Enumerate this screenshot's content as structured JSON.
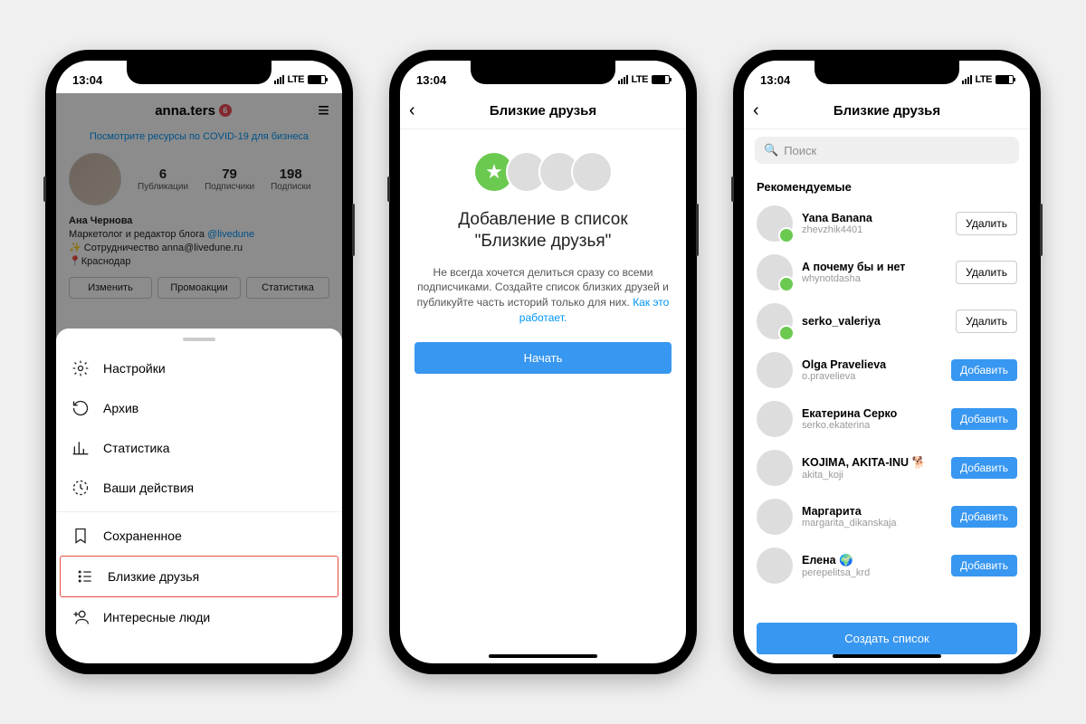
{
  "status": {
    "time": "13:04",
    "net": "LTE"
  },
  "phone1": {
    "username": "anna.ters",
    "badge": "6",
    "covid_link": "Посмотрите ресурсы по COVID-19 для бизнеса",
    "stats": [
      {
        "n": "6",
        "l": "Публикации"
      },
      {
        "n": "79",
        "l": "Подписчики"
      },
      {
        "n": "198",
        "l": "Подписки"
      }
    ],
    "bio_name": "Ана Чернова",
    "bio_line1_a": "Маркетолог и редактор блога ",
    "bio_line1_link": "@livedune",
    "bio_line2": "✨ Сотрудничество anna@livedune.ru",
    "bio_line3": "📍Краснодар",
    "tabs": [
      "Изменить",
      "Промоакции",
      "Статистика"
    ],
    "sheet": {
      "group1": [
        {
          "icon": "gear",
          "label": "Настройки"
        },
        {
          "icon": "archive",
          "label": "Архив"
        },
        {
          "icon": "stats",
          "label": "Статистика"
        },
        {
          "icon": "activity",
          "label": "Ваши действия"
        }
      ],
      "group2": [
        {
          "icon": "bookmark",
          "label": "Сохраненное",
          "hl": false
        },
        {
          "icon": "list",
          "label": "Близкие друзья",
          "hl": true
        },
        {
          "icon": "addperson",
          "label": "Интересные люди",
          "hl": false
        }
      ]
    }
  },
  "phone2": {
    "nav_title": "Близкие друзья",
    "heading_l1": "Добавление в список",
    "heading_l2": "\"Близкие друзья\"",
    "desc": "Не всегда хочется делиться сразу со всеми подписчиками. Создайте список близких друзей и публикуйте часть историй только для них. ",
    "desc_link": "Как это работает.",
    "start_btn": "Начать"
  },
  "phone3": {
    "nav_title": "Близкие друзья",
    "search_placeholder": "Поиск",
    "section": "Рекомендуемые",
    "btn_remove": "Удалить",
    "btn_add": "Добавить",
    "btn_create": "Создать список",
    "friends": [
      {
        "name": "Yana Banana",
        "user": "zhevzhik4401",
        "added": true,
        "av": "av-1"
      },
      {
        "name": "А почему бы и нет",
        "user": "whynotdasha",
        "added": true,
        "av": "av-2"
      },
      {
        "name": "serko_valeriya",
        "user": "",
        "added": true,
        "av": "av-3"
      },
      {
        "name": "Olga Pravelieva",
        "user": "o.pravelieva",
        "added": false,
        "av": "av-4"
      },
      {
        "name": "Екатерина Серко",
        "user": "serko.ekaterina",
        "added": false,
        "av": "av-5"
      },
      {
        "name": "KOJIMA, AKITA-INU 🐕",
        "user": "akita_koji",
        "added": false,
        "av": "av-6"
      },
      {
        "name": "Маргарита",
        "user": "margarita_dikanskaja",
        "added": false,
        "av": "av-7"
      },
      {
        "name": "Елена 🌍",
        "user": "perepelitsa_krd",
        "added": false,
        "av": "av-8"
      }
    ]
  },
  "icons": {
    "gear": "⚙",
    "archive": "↻",
    "stats": "⫿",
    "activity": "◔",
    "bookmark": "⟃",
    "list": "☰",
    "addperson": "+⚇",
    "star": "★",
    "search": "🔍",
    "back": "‹",
    "burger": "≡",
    "location_arrow": "➤"
  }
}
